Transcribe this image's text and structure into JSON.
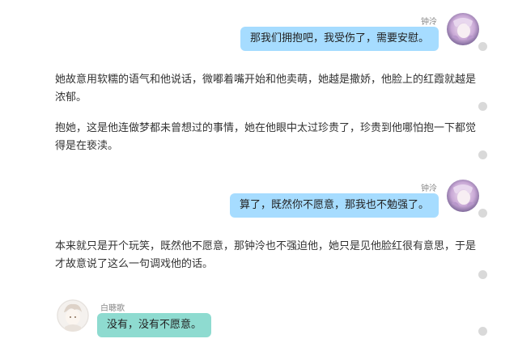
{
  "messages": [
    {
      "sender": "钟泠",
      "text": "那我们拥抱吧，我受伤了，需要安慰。"
    },
    {
      "narration": "她故意用软糯的语气和他说话，微嘟着嘴开始和他卖萌，她越是撒娇，他脸上的红霞就越是浓郁。"
    },
    {
      "narration": "抱她，这是他连做梦都未曾想过的事情，她在他眼中太过珍贵了，珍贵到他哪怕抱一下都觉得是在亵渎。"
    },
    {
      "sender": "钟泠",
      "text": "算了，既然你不愿意，那我也不勉强了。"
    },
    {
      "narration": "本来就只是开个玩笑，既然他不愿意，那钟泠也不强迫他，她只是见他脸红很有意思，于是才故意说了这么一句调戏他的话。"
    },
    {
      "sender": "白聴歌",
      "text": "没有，没有不愿意。"
    }
  ],
  "icons": {
    "avatar_right": "girl-avatar",
    "avatar_left": "boy-avatar",
    "dot": "menu-dot-icon"
  },
  "colors": {
    "bubble_right": "#a6dcff",
    "bubble_left": "#8edbd0",
    "dot": "#d9d9d9"
  }
}
